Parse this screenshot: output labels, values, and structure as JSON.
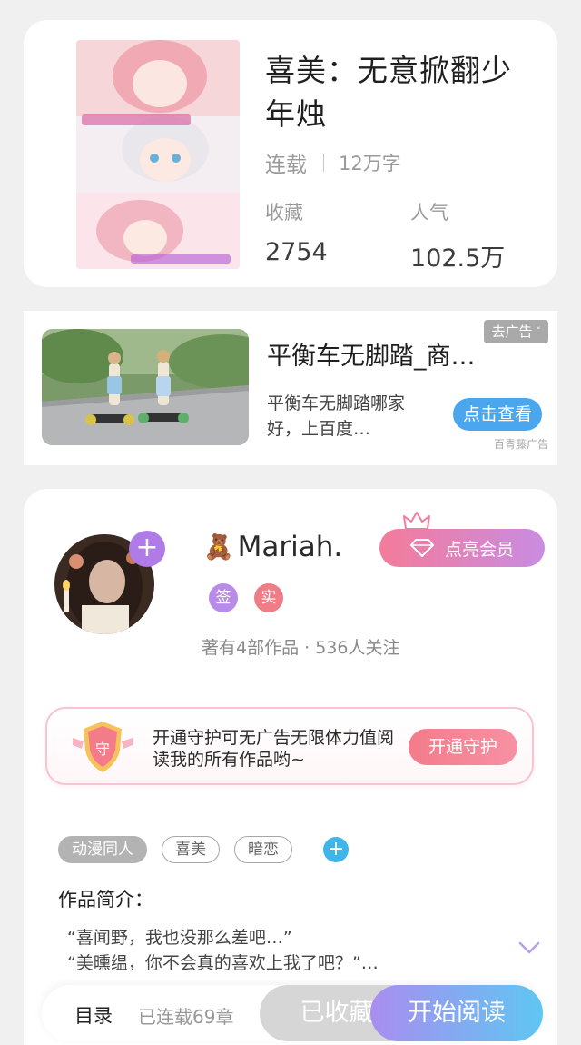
{
  "book": {
    "title": "喜美：无意掀翻少年烛",
    "status": "连载",
    "word_count": "12万字",
    "favorites_label": "收藏",
    "favorites_value": "2754",
    "popularity_label": "人气",
    "popularity_value": "102.5万",
    "cover_icon": "book-cover-image"
  },
  "ad": {
    "close_label": "去广告",
    "close_chevron": "˅",
    "title": "平衡车无脚踏_商…",
    "description": "平衡车无脚踏哪家好，上百度…",
    "cta_label": "点击查看",
    "source": "百青藤广告"
  },
  "author": {
    "name": "Mariah.",
    "name_emoji": "🧸",
    "follow_plus": "+",
    "badge_sign": "签",
    "badge_real": "实",
    "stats": "著有4部作品 · 536人关注",
    "vip_label": "点亮会员"
  },
  "guard": {
    "icon_text": "守",
    "text": "开通守护可无广告无限体力值阅读我的所有作品哟~",
    "button_label": "开通守护"
  },
  "tags": {
    "items": [
      "动漫同人",
      "喜美",
      "暗恋"
    ],
    "add_label": "+"
  },
  "intro": {
    "label": "作品简介：",
    "text": "“喜闻野，我也没那么差吧…”\n“美曛缊，你不会真的喜欢上我了吧？”…"
  },
  "bottom_bar": {
    "toc_label": "目录",
    "serial_count": "已连载69章",
    "favorited_label": "已收藏",
    "read_label": "开始阅读"
  },
  "colors": {
    "accent_blue": "#4aa6ef",
    "vip_gradient_start": "#f47b9a",
    "vip_gradient_end": "#c98ce2",
    "read_gradient_start": "#a98df0",
    "read_gradient_end": "#5fc6f2"
  }
}
